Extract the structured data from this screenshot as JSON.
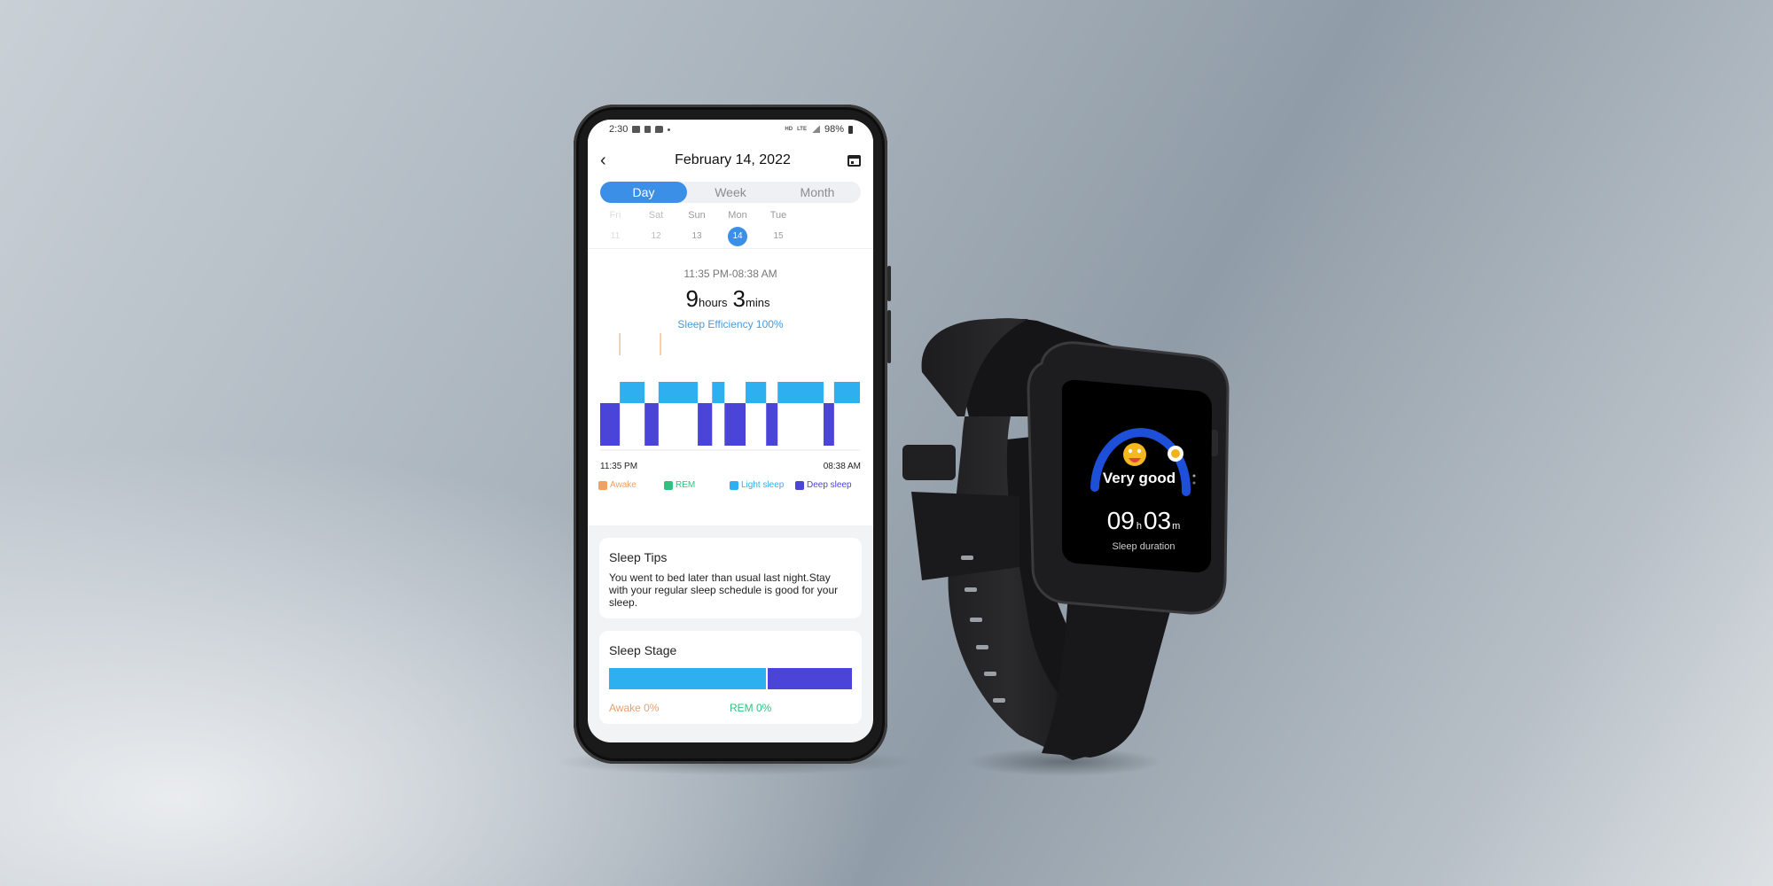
{
  "statusbar": {
    "time": "2:30",
    "left_icons": [
      "gallery-icon",
      "app-icon",
      "message-icon",
      "dot-icon"
    ],
    "hd": "HD",
    "lte": "LTE",
    "battery": "98%"
  },
  "header": {
    "back_icon": "chevron-left-icon",
    "title": "February 14, 2022",
    "calendar_icon": "calendar-icon"
  },
  "tabs": [
    {
      "label": "Day",
      "active": true
    },
    {
      "label": "Week",
      "active": false
    },
    {
      "label": "Month",
      "active": false
    }
  ],
  "days": [
    {
      "name": "Fri",
      "date": "11",
      "state": "faint"
    },
    {
      "name": "Sat",
      "date": "12",
      "state": "mid"
    },
    {
      "name": "Sun",
      "date": "13",
      "state": "normal"
    },
    {
      "name": "Mon",
      "date": "14",
      "state": "active"
    },
    {
      "name": "Tue",
      "date": "15",
      "state": "normal"
    }
  ],
  "summary": {
    "range": "11:35 PM-08:38 AM",
    "hours": "9",
    "hours_unit": "hours",
    "mins": "3",
    "mins_unit": "mins",
    "efficiency": "Sleep Efficiency 100%"
  },
  "colors": {
    "accent": "#3b8fe6",
    "awake": "#f0a060",
    "rem": "#2ec27e",
    "light": "#2eb0f0",
    "deep": "#4a44d8",
    "efficiency_text": "#4a9ad9"
  },
  "chart_data": {
    "type": "bar",
    "title": "",
    "xlabel": "",
    "ylabel": "",
    "x_start_label": "11:35 PM",
    "x_end_label": "08:38 AM",
    "x_unit": "minutes since 11:35 PM",
    "xlim": [
      0,
      543
    ],
    "levels": [
      "Awake",
      "REM",
      "Light sleep",
      "Deep sleep"
    ],
    "segments": [
      {
        "stage": "Deep sleep",
        "start": 0,
        "end": 41
      },
      {
        "stage": "Light sleep",
        "start": 41,
        "end": 93
      },
      {
        "stage": "Deep sleep",
        "start": 93,
        "end": 122
      },
      {
        "stage": "Light sleep",
        "start": 122,
        "end": 204
      },
      {
        "stage": "Deep sleep",
        "start": 204,
        "end": 234
      },
      {
        "stage": "Light sleep",
        "start": 234,
        "end": 260
      },
      {
        "stage": "Deep sleep",
        "start": 260,
        "end": 304
      },
      {
        "stage": "Light sleep",
        "start": 304,
        "end": 347
      },
      {
        "stage": "Deep sleep",
        "start": 347,
        "end": 371
      },
      {
        "stage": "Light sleep",
        "start": 371,
        "end": 467
      },
      {
        "stage": "Deep sleep",
        "start": 467,
        "end": 489
      },
      {
        "stage": "Light sleep",
        "start": 489,
        "end": 543
      }
    ],
    "awake_marks": [
      41,
      126
    ],
    "legend": [
      {
        "label": "Awake",
        "key": "awake"
      },
      {
        "label": "REM",
        "key": "rem"
      },
      {
        "label": "Light sleep",
        "key": "light"
      },
      {
        "label": "Deep sleep",
        "key": "deep"
      }
    ],
    "legend_position": "bottom"
  },
  "tips": {
    "title": "Sleep Tips",
    "text": "You went to bed later than usual last night.Stay with your regular sleep schedule is good for your sleep."
  },
  "stage": {
    "title": "Sleep Stage",
    "bar": [
      {
        "stage": "Light sleep",
        "percent": 65,
        "key": "light"
      },
      {
        "stage": "Deep sleep",
        "percent": 35,
        "key": "deep"
      }
    ],
    "labels": [
      {
        "label": "Awake 0%",
        "key": "awake"
      },
      {
        "label": "REM 0%",
        "key": "rem"
      }
    ]
  },
  "watch": {
    "rating": "Very good",
    "rating_progress": 0.9,
    "hours": "09",
    "hours_unit": "h",
    "mins": "03",
    "mins_unit": "m",
    "caption": "Sleep duration",
    "arc_color": "#1e4fd8"
  }
}
